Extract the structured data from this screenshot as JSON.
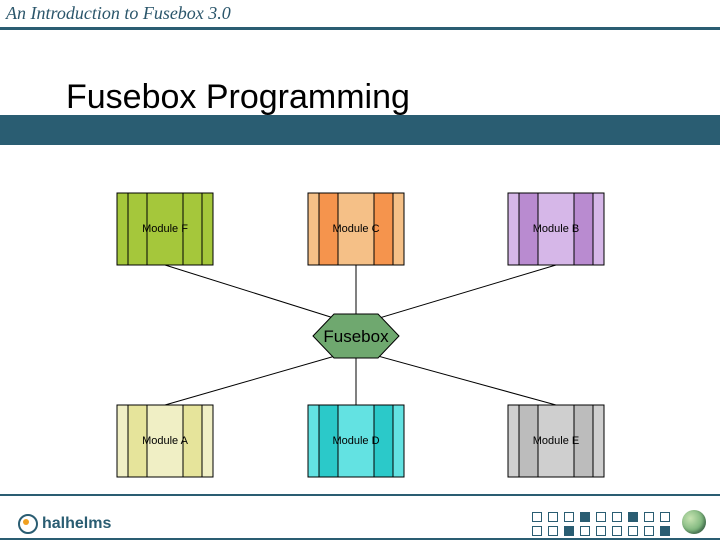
{
  "title": "An Introduction to Fusebox 3.0",
  "heading": "Fusebox Programming",
  "hub_label": "Fusebox",
  "modules": {
    "top_left": {
      "label": "Module F",
      "fill": "#a5c73b",
      "inner": "#a5c73b"
    },
    "top_mid": {
      "label": "Module C",
      "fill": "#f5c087",
      "inner": "#f5944d"
    },
    "top_right": {
      "label": "Module B",
      "fill": "#d6b7e8",
      "inner": "#b98bd0"
    },
    "bot_left": {
      "label": "Module A",
      "fill": "#f0efc5",
      "inner": "#e6e49b"
    },
    "bot_mid": {
      "label": "Module D",
      "fill": "#63e2e2",
      "inner": "#2bc9c9"
    },
    "bot_right": {
      "label": "Module E",
      "fill": "#cfcfcf",
      "inner": "#bcbcbc"
    }
  },
  "hexagon_fill": "#6fa86f",
  "footer_logo_text": "halhelms"
}
